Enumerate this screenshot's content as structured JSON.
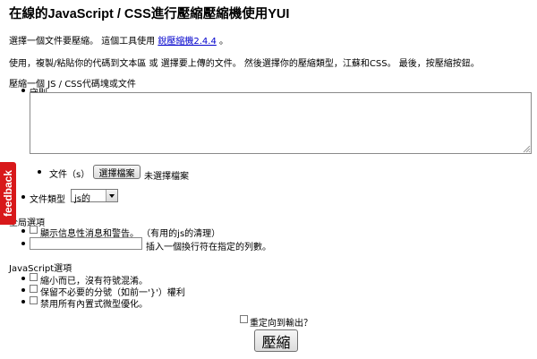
{
  "page": {
    "title": "在線的JavaScript / CSS進行壓縮壓縮機使用YUI",
    "intro_text": "選擇一個文件要壓縮。 這個工具使用",
    "intro_link": "銳壓縮機2.4.4",
    "intro_end": "。",
    "instructions": "使用，複製/粘貼你的代碼到文本區 或 選擇要上傳的文件。 然後選擇你的壓縮類型，江蘇和CSS。 最後，按壓縮按鈕。"
  },
  "source": {
    "heading": "壓縮一個 JS / CSS代碼塊或文件",
    "code_label": "守則",
    "code_value": "",
    "file_label": "文件（s）",
    "file_button": "選擇檔案",
    "file_status": "未選擇檔案",
    "filetype_label": "文件類型",
    "filetype_value": "js的"
  },
  "global_options": {
    "heading": "全局選項",
    "verbose": {
      "label": "顯示信息性消息和警告。 （有用的js的清理）",
      "checked": false
    },
    "linebreak_value": "",
    "linebreak_label": "插入一個換行符在指定的列數。"
  },
  "js_options": {
    "heading": "JavaScript選項",
    "items": [
      {
        "label": "縮小而已，沒有符號混淆。",
        "checked": false
      },
      {
        "label": "保留不必要的分號（如前一'}'）權利",
        "checked": false
      },
      {
        "label": "禁用所有內置式微型優化。",
        "checked": false
      }
    ]
  },
  "output": {
    "redirect_label": "重定向到輸出？",
    "compress_button": "壓縮"
  },
  "feedback_tab": "feedback"
}
